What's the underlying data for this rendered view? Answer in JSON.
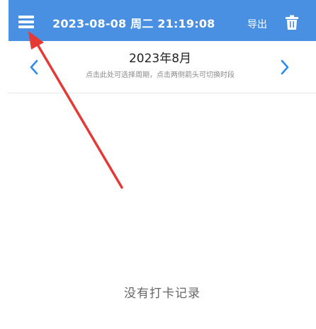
{
  "header": {
    "datetime": "2023-08-08 周二 21:19:08",
    "export_label": "导出",
    "icons": {
      "menu": "hamburger-menu-icon",
      "trash": "trash-icon"
    }
  },
  "period": {
    "title": "2023年8月",
    "hint": "点击此处可选择周期，点击两侧箭头可切换时段",
    "icons": {
      "prev": "chevron-left-icon",
      "next": "chevron-right-icon"
    }
  },
  "empty_state": {
    "message": "没有打卡记录"
  },
  "colors": {
    "header_bg": "#4a90e2",
    "accent_chevron": "#2d8ceb",
    "annotation_arrow": "#e53935"
  }
}
